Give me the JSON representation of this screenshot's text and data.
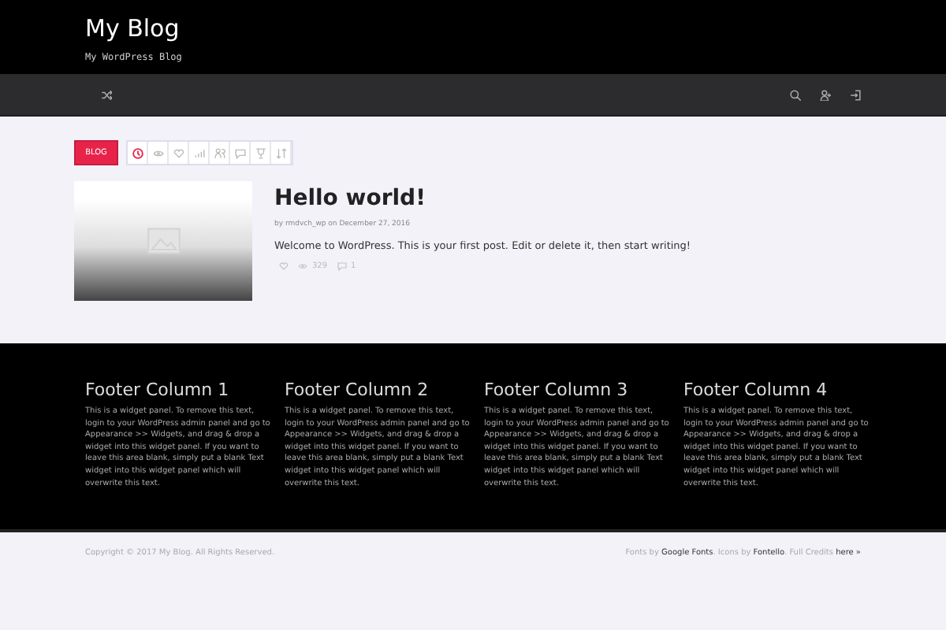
{
  "site": {
    "title": "My Blog",
    "tagline": "My WordPress Blog"
  },
  "nav": {
    "left_icons": [
      {
        "kind": "shuffle"
      }
    ],
    "right_icons": [
      {
        "kind": "search"
      },
      {
        "kind": "user-add"
      },
      {
        "kind": "login"
      }
    ]
  },
  "filter_bar": {
    "category": "BLOG",
    "filters": [
      {
        "kind": "clock",
        "selected": true
      },
      {
        "kind": "eye",
        "selected": false
      },
      {
        "kind": "heart",
        "selected": false
      },
      {
        "kind": "bars",
        "selected": false
      },
      {
        "kind": "users",
        "selected": false
      },
      {
        "kind": "comment",
        "selected": false
      },
      {
        "kind": "trophy",
        "selected": false
      },
      {
        "kind": "sort",
        "selected": false
      }
    ]
  },
  "posts": [
    {
      "title": "Hello world!",
      "meta": "by rmdvch_wp on December 27, 2016",
      "excerpt": "Welcome to WordPress. This is your first post. Edit or delete it, then start writing!",
      "views": "329",
      "comments": "1"
    }
  ],
  "footer_columns": [
    {
      "heading": "Footer Column 1",
      "text": "This is a widget panel. To remove this text, login to your WordPress admin panel and go to Appearance >> Widgets, and drag & drop a widget into this widget panel. If you want to leave this area blank, simply put a blank Text widget into this widget panel which will overwrite this text."
    },
    {
      "heading": "Footer Column 2",
      "text": "This is a widget panel. To remove this text, login to your WordPress admin panel and go to Appearance >> Widgets, and drag & drop a widget into this widget panel. If you want to leave this area blank, simply put a blank Text widget into this widget panel which will overwrite this text."
    },
    {
      "heading": "Footer Column 3",
      "text": "This is a widget panel. To remove this text, login to your WordPress admin panel and go to Appearance >> Widgets, and drag & drop a widget into this widget panel. If you want to leave this area blank, simply put a blank Text widget into this widget panel which will overwrite this text."
    },
    {
      "heading": "Footer Column 4",
      "text": "This is a widget panel. To remove this text, login to your WordPress admin panel and go to Appearance >> Widgets, and drag & drop a widget into this widget panel. If you want to leave this area blank, simply put a blank Text widget into this widget panel which will overwrite this text."
    }
  ],
  "bottom_bar": {
    "copyright": "Copyright © 2017 My Blog. All Rights Reserved.",
    "credits": [
      {
        "text": "Fonts by ",
        "link": false
      },
      {
        "text": "Google Fonts",
        "link": true
      },
      {
        "text": ". Icons by ",
        "link": false
      },
      {
        "text": "Fontello",
        "link": true
      },
      {
        "text": ". Full Credits ",
        "link": false
      },
      {
        "text": "here »",
        "link": true
      }
    ]
  }
}
